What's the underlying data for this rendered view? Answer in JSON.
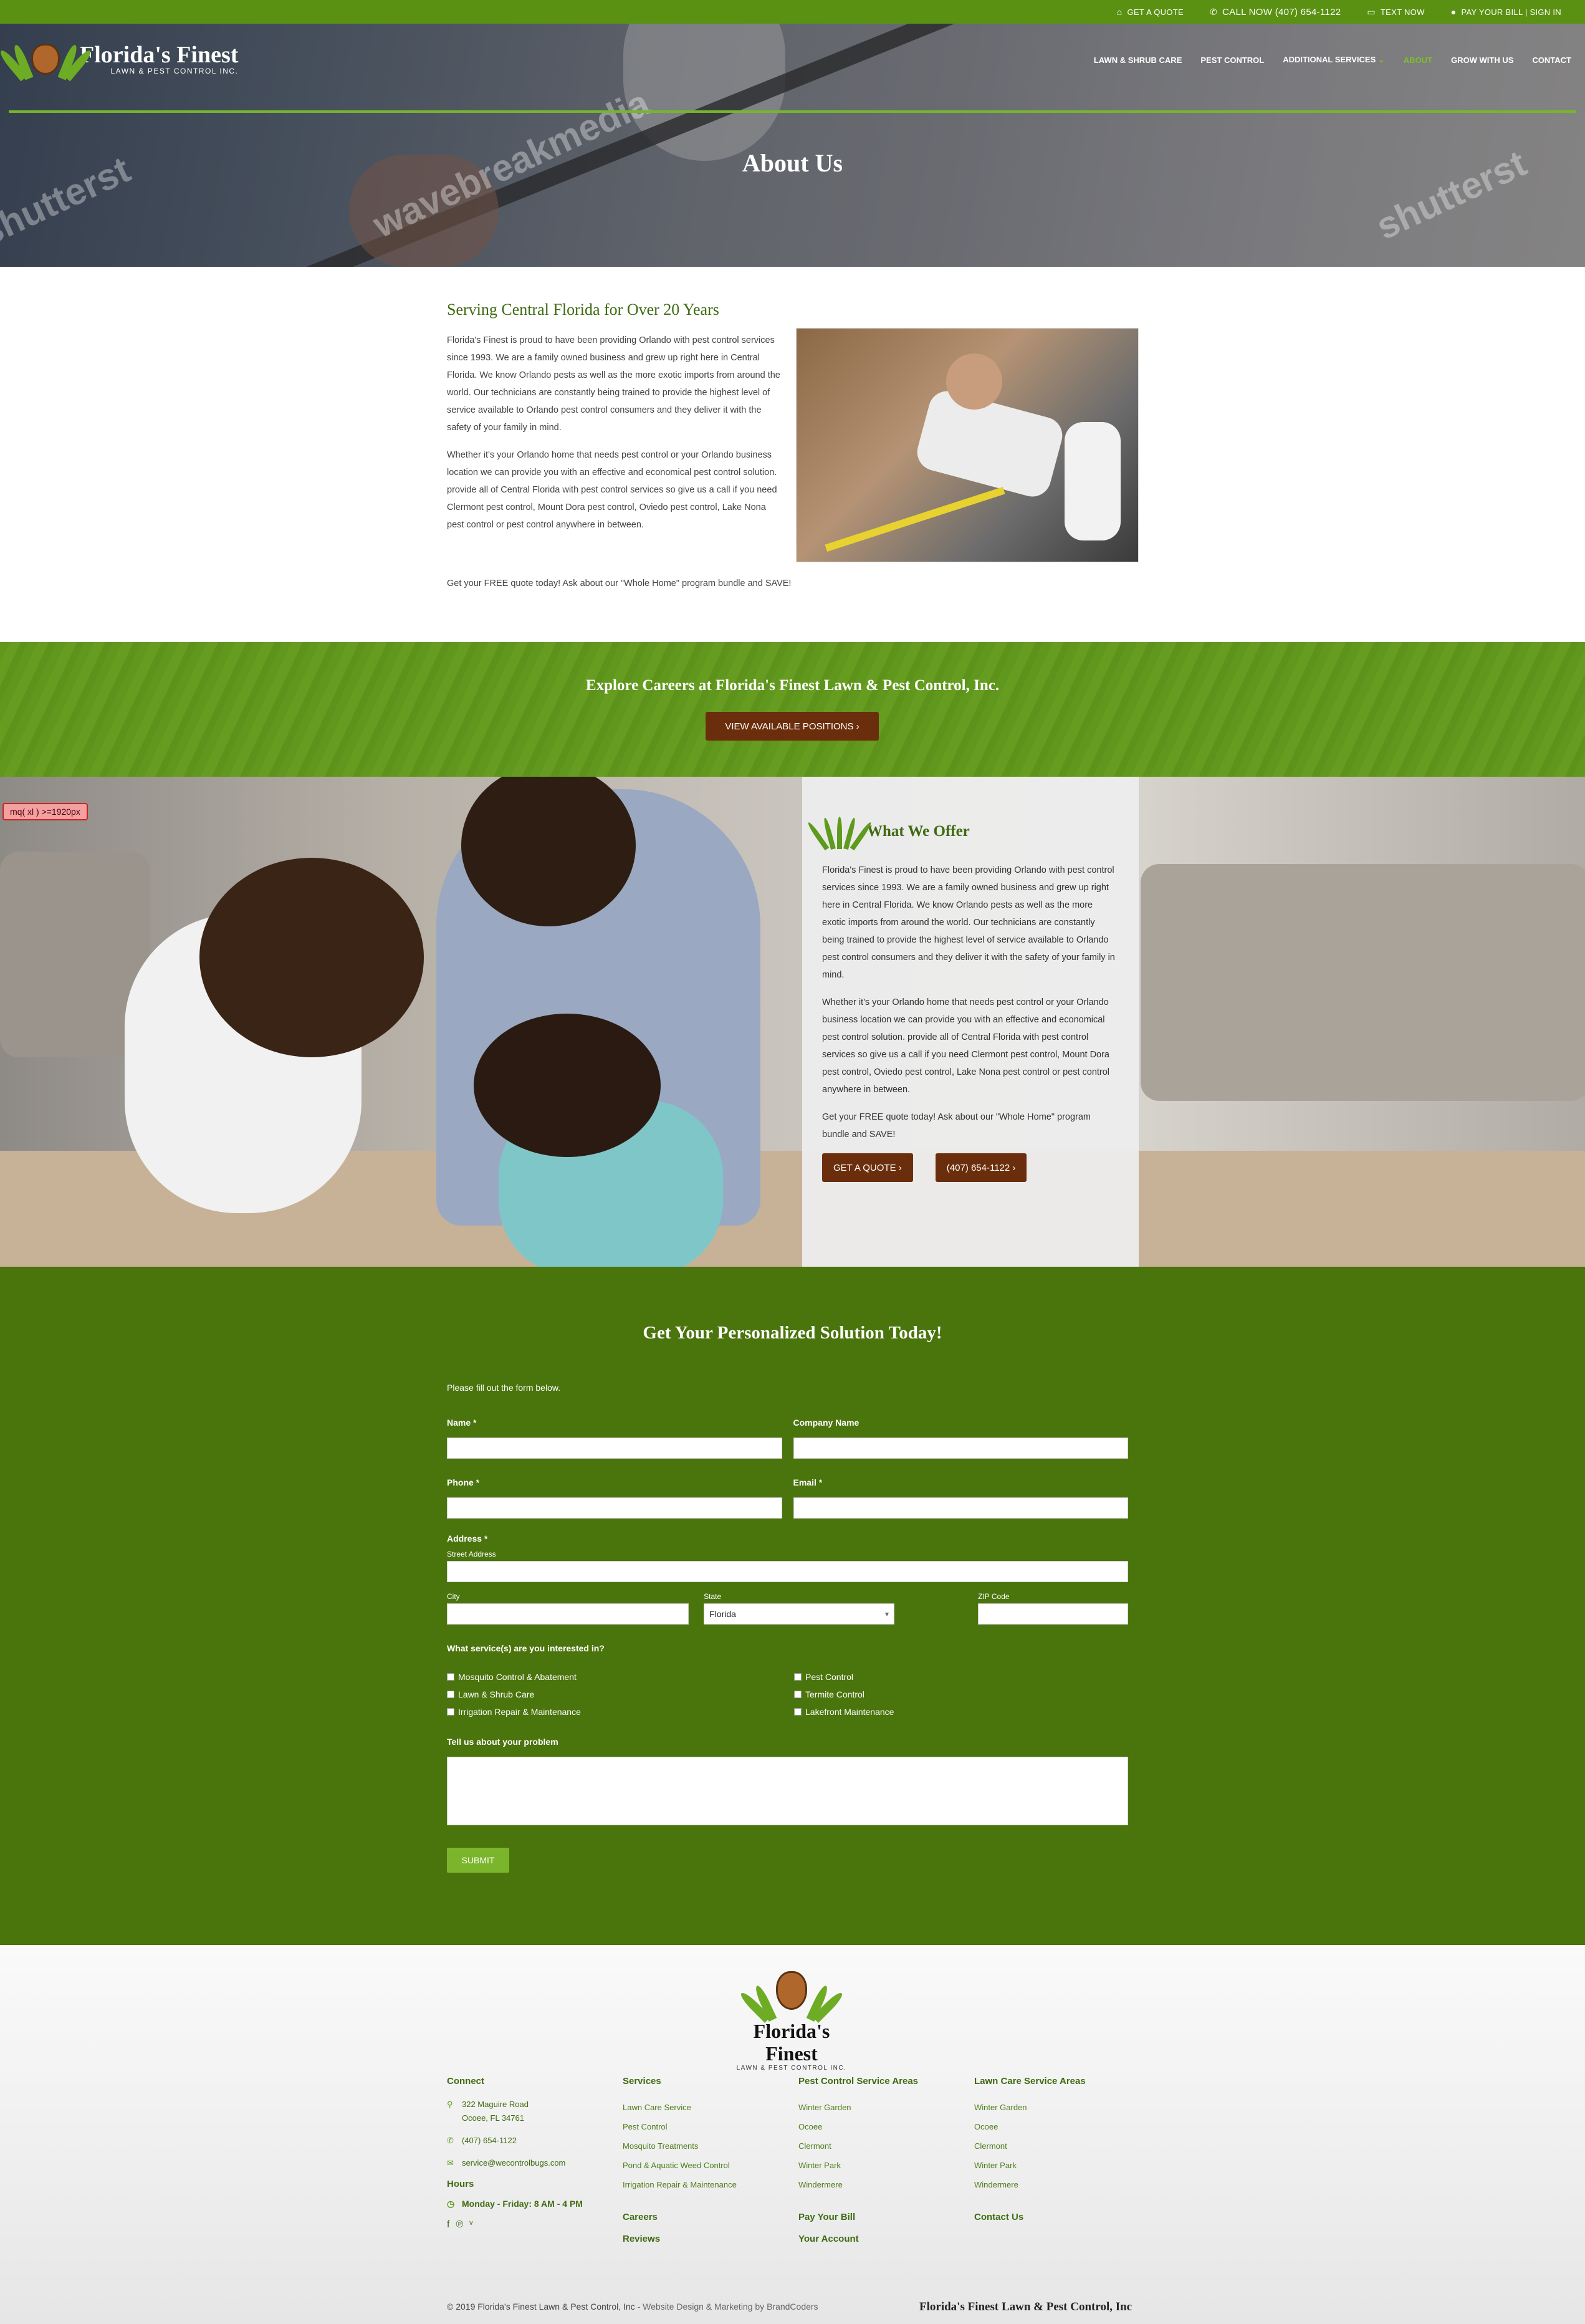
{
  "topbar": {
    "quote": "GET A QUOTE",
    "call": "CALL NOW (407) 654-1122",
    "text": "TEXT NOW",
    "pay": "PAY YOUR BILL | SIGN IN"
  },
  "brand": {
    "name": "Florida's Finest",
    "tagline": "LAWN & PEST CONTROL INC."
  },
  "nav": {
    "items": [
      "LAWN & SHRUB CARE",
      "PEST CONTROL",
      "ADDITIONAL SERVICES",
      "ABOUT",
      "GROW WITH US",
      "CONTACT"
    ],
    "active": "ABOUT"
  },
  "hero": {
    "title": "About Us",
    "watermarks": [
      "wavebreakmedia",
      "shutterst",
      "shutterst"
    ]
  },
  "intro": {
    "heading": "Serving Central Florida for Over 20 Years",
    "p1": "Florida's Finest is proud to have been providing Orlando with pest control services since 1993. We are a family owned business and grew up right here in Central Florida. We know Orlando pests as well as the more exotic imports from around the world. Our technicians are constantly being trained to provide the highest level of service available to Orlando pest control consumers and they deliver it with the safety of your family in mind.",
    "p2": "Whether it's your Orlando home that needs pest control or your Orlando business location we can provide you with an effective and economical pest control solution. provide all of Central Florida with pest control services so give us a call if you need Clermont pest control, Mount Dora pest control, Oviedo pest control, Lake Nona pest control or pest control anywhere in between.",
    "cta": "Get your FREE quote today! Ask about our \"Whole Home\" program bundle and SAVE!"
  },
  "careers": {
    "heading": "Explore Careers at Florida's Finest Lawn & Pest Control, Inc.",
    "button": "VIEW AVAILABLE POSITIONS"
  },
  "offer": {
    "heading": "What We Offer",
    "p1": "Florida's Finest is proud to have been providing Orlando with pest control services since 1993. We are a family owned business and grew up right here in Central Florida. We know Orlando pests as well as the more exotic imports from around the world. Our technicians are constantly being trained to provide the highest level of service available to Orlando pest control consumers and they deliver it with the safety of your family in mind.",
    "p2": "Whether it's your Orlando home that needs pest control or your Orlando business location we can provide you with an effective and economical pest control solution. provide all of Central Florida with pest control services so give us a call if you need Clermont pest control, Mount Dora pest control, Oviedo pest control, Lake Nona pest control or pest control anywhere in between.",
    "p3": "Get your FREE quote today! Ask about our \"Whole Home\" program bundle and SAVE!",
    "btn_quote": "GET A QUOTE",
    "btn_phone": "(407) 654-1122"
  },
  "debug_badge": "mq( xl ) >=1920px",
  "form": {
    "heading": "Get Your Personalized Solution Today!",
    "intro": "Please fill out the form below.",
    "name_label": "Name *",
    "company_label": "Company Name",
    "phone_label": "Phone *",
    "email_label": "Email *",
    "address_label": "Address *",
    "street_label": "Street Address",
    "city_label": "City",
    "state_label": "State",
    "state_value": "Florida",
    "zip_label": "ZIP Code",
    "services_label": "What service(s) are you interested in?",
    "services_left": [
      "Mosquito Control & Abatement",
      "Lawn & Shrub Care",
      "Irrigation Repair & Maintenance"
    ],
    "services_right": [
      "Pest Control",
      "Termite Control",
      "Lakefront Maintenance"
    ],
    "problem_label": "Tell us about your problem",
    "submit": "SUBMIT"
  },
  "footer": {
    "brand_name": "Florida's Finest",
    "brand_tagline": "LAWN & PEST CONTROL INC.",
    "connect": {
      "heading": "Connect",
      "address1": "322 Maguire Road",
      "address2": "Ocoee, FL 34761",
      "phone": "(407) 654-1122",
      "email": "service@wecontrolbugs.com",
      "hours_heading": "Hours",
      "hours": "Monday - Friday: 8 AM - 4 PM"
    },
    "services": {
      "heading": "Services",
      "items": [
        "Lawn Care Service",
        "Pest Control",
        "Mosquito Treatments",
        "Pond & Aquatic Weed Control",
        "Irrigation Repair & Maintenance"
      ],
      "careers": "Careers",
      "reviews": "Reviews"
    },
    "pest_areas": {
      "heading": "Pest Control Service Areas",
      "items": [
        "Winter Garden",
        "Ocoee",
        "Clermont",
        "Winter Park",
        "Windermere"
      ],
      "pay": "Pay Your Bill",
      "account": "Your Account"
    },
    "lawn_areas": {
      "heading": "Lawn Care Service Areas",
      "items": [
        "Winter Garden",
        "Ocoee",
        "Clermont",
        "Winter Park",
        "Windermere"
      ],
      "contact": "Contact Us"
    },
    "copyright": "© 2019 Florida's Finest Lawn & Pest Control, Inc",
    "credit": " - Website Design & Marketing by BrandCoders",
    "bottom_name": "Florida's Finest Lawn & Pest Control, Inc"
  }
}
